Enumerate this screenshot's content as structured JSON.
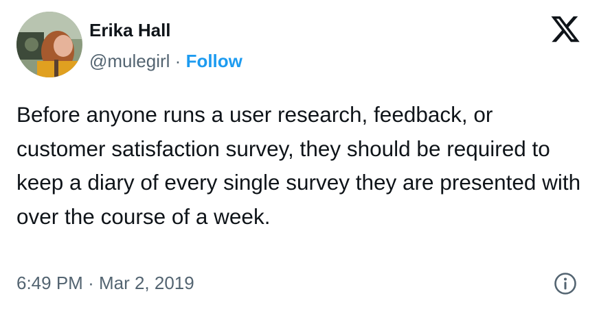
{
  "author": {
    "name": "Erika Hall",
    "handle": "@mulegirl",
    "separator": "·",
    "follow_label": "Follow"
  },
  "tweet": {
    "text": "Before anyone runs a user research, feedback, or customer satisfaction survey, they should be required to keep a diary of every single survey they are presented with over the course of a week.",
    "time": "6:49 PM",
    "date_separator": "·",
    "date": "Mar 2, 2019"
  },
  "icons": {
    "brand": "x-logo-icon",
    "info": "info-icon"
  },
  "colors": {
    "text": "#0f1419",
    "secondary": "#536471",
    "accent": "#1d9bf0"
  }
}
